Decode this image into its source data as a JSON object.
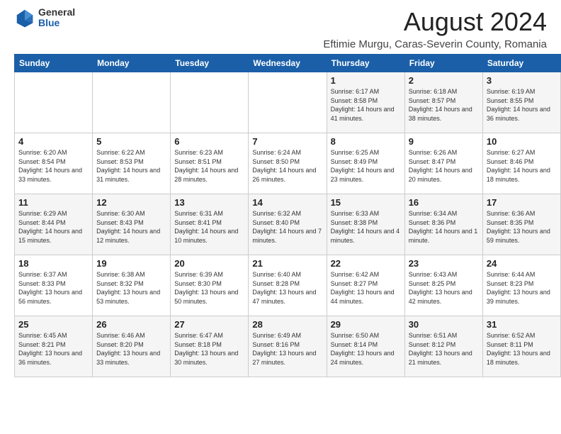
{
  "header": {
    "logo_general": "General",
    "logo_blue": "Blue",
    "month_year": "August 2024",
    "location": "Eftimie Murgu, Caras-Severin County, Romania"
  },
  "days_of_week": [
    "Sunday",
    "Monday",
    "Tuesday",
    "Wednesday",
    "Thursday",
    "Friday",
    "Saturday"
  ],
  "weeks": [
    [
      {
        "day": "",
        "info": ""
      },
      {
        "day": "",
        "info": ""
      },
      {
        "day": "",
        "info": ""
      },
      {
        "day": "",
        "info": ""
      },
      {
        "day": "1",
        "info": "Sunrise: 6:17 AM\nSunset: 8:58 PM\nDaylight: 14 hours and 41 minutes."
      },
      {
        "day": "2",
        "info": "Sunrise: 6:18 AM\nSunset: 8:57 PM\nDaylight: 14 hours and 38 minutes."
      },
      {
        "day": "3",
        "info": "Sunrise: 6:19 AM\nSunset: 8:55 PM\nDaylight: 14 hours and 36 minutes."
      }
    ],
    [
      {
        "day": "4",
        "info": "Sunrise: 6:20 AM\nSunset: 8:54 PM\nDaylight: 14 hours and 33 minutes."
      },
      {
        "day": "5",
        "info": "Sunrise: 6:22 AM\nSunset: 8:53 PM\nDaylight: 14 hours and 31 minutes."
      },
      {
        "day": "6",
        "info": "Sunrise: 6:23 AM\nSunset: 8:51 PM\nDaylight: 14 hours and 28 minutes."
      },
      {
        "day": "7",
        "info": "Sunrise: 6:24 AM\nSunset: 8:50 PM\nDaylight: 14 hours and 26 minutes."
      },
      {
        "day": "8",
        "info": "Sunrise: 6:25 AM\nSunset: 8:49 PM\nDaylight: 14 hours and 23 minutes."
      },
      {
        "day": "9",
        "info": "Sunrise: 6:26 AM\nSunset: 8:47 PM\nDaylight: 14 hours and 20 minutes."
      },
      {
        "day": "10",
        "info": "Sunrise: 6:27 AM\nSunset: 8:46 PM\nDaylight: 14 hours and 18 minutes."
      }
    ],
    [
      {
        "day": "11",
        "info": "Sunrise: 6:29 AM\nSunset: 8:44 PM\nDaylight: 14 hours and 15 minutes."
      },
      {
        "day": "12",
        "info": "Sunrise: 6:30 AM\nSunset: 8:43 PM\nDaylight: 14 hours and 12 minutes."
      },
      {
        "day": "13",
        "info": "Sunrise: 6:31 AM\nSunset: 8:41 PM\nDaylight: 14 hours and 10 minutes."
      },
      {
        "day": "14",
        "info": "Sunrise: 6:32 AM\nSunset: 8:40 PM\nDaylight: 14 hours and 7 minutes."
      },
      {
        "day": "15",
        "info": "Sunrise: 6:33 AM\nSunset: 8:38 PM\nDaylight: 14 hours and 4 minutes."
      },
      {
        "day": "16",
        "info": "Sunrise: 6:34 AM\nSunset: 8:36 PM\nDaylight: 14 hours and 1 minute."
      },
      {
        "day": "17",
        "info": "Sunrise: 6:36 AM\nSunset: 8:35 PM\nDaylight: 13 hours and 59 minutes."
      }
    ],
    [
      {
        "day": "18",
        "info": "Sunrise: 6:37 AM\nSunset: 8:33 PM\nDaylight: 13 hours and 56 minutes."
      },
      {
        "day": "19",
        "info": "Sunrise: 6:38 AM\nSunset: 8:32 PM\nDaylight: 13 hours and 53 minutes."
      },
      {
        "day": "20",
        "info": "Sunrise: 6:39 AM\nSunset: 8:30 PM\nDaylight: 13 hours and 50 minutes."
      },
      {
        "day": "21",
        "info": "Sunrise: 6:40 AM\nSunset: 8:28 PM\nDaylight: 13 hours and 47 minutes."
      },
      {
        "day": "22",
        "info": "Sunrise: 6:42 AM\nSunset: 8:27 PM\nDaylight: 13 hours and 44 minutes."
      },
      {
        "day": "23",
        "info": "Sunrise: 6:43 AM\nSunset: 8:25 PM\nDaylight: 13 hours and 42 minutes."
      },
      {
        "day": "24",
        "info": "Sunrise: 6:44 AM\nSunset: 8:23 PM\nDaylight: 13 hours and 39 minutes."
      }
    ],
    [
      {
        "day": "25",
        "info": "Sunrise: 6:45 AM\nSunset: 8:21 PM\nDaylight: 13 hours and 36 minutes."
      },
      {
        "day": "26",
        "info": "Sunrise: 6:46 AM\nSunset: 8:20 PM\nDaylight: 13 hours and 33 minutes."
      },
      {
        "day": "27",
        "info": "Sunrise: 6:47 AM\nSunset: 8:18 PM\nDaylight: 13 hours and 30 minutes."
      },
      {
        "day": "28",
        "info": "Sunrise: 6:49 AM\nSunset: 8:16 PM\nDaylight: 13 hours and 27 minutes."
      },
      {
        "day": "29",
        "info": "Sunrise: 6:50 AM\nSunset: 8:14 PM\nDaylight: 13 hours and 24 minutes."
      },
      {
        "day": "30",
        "info": "Sunrise: 6:51 AM\nSunset: 8:12 PM\nDaylight: 13 hours and 21 minutes."
      },
      {
        "day": "31",
        "info": "Sunrise: 6:52 AM\nSunset: 8:11 PM\nDaylight: 13 hours and 18 minutes."
      }
    ]
  ]
}
